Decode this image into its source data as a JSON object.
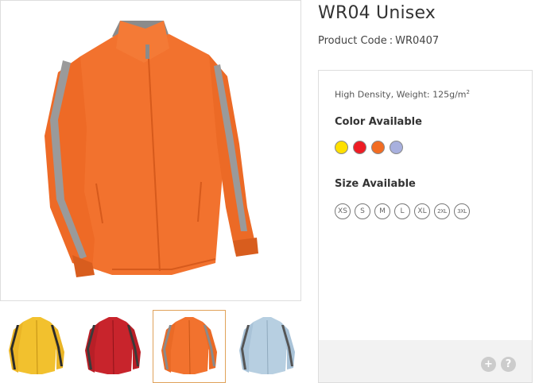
{
  "product": {
    "title": "WR04 Unisex",
    "code_label": "Product Code",
    "code_separator": ":",
    "code_value": "WR0407"
  },
  "gallery": {
    "main_alt": "Orange windbreaker jacket",
    "thumbnails": [
      {
        "color_name": "yellow",
        "fill": "#f2c12e",
        "stripe": "#2b2b2b"
      },
      {
        "color_name": "red",
        "fill": "#c8242c",
        "stripe": "#3a3a3a"
      },
      {
        "color_name": "orange",
        "fill": "#f2722e",
        "stripe": "#8a8a8a"
      },
      {
        "color_name": "light-blue",
        "fill": "#b7cfe1",
        "stripe": "#555555"
      }
    ],
    "active_index": 2
  },
  "specs": {
    "material_text": "High Density, Weight: 125g/m",
    "material_superscript": "2"
  },
  "colors": {
    "title": "Color Available",
    "swatches": [
      {
        "name": "yellow",
        "hex": "#ffe000"
      },
      {
        "name": "red",
        "hex": "#ee1c24"
      },
      {
        "name": "orange",
        "hex": "#f26c22"
      },
      {
        "name": "lavender",
        "hex": "#a8b0de"
      }
    ]
  },
  "sizes": {
    "title": "Size Available",
    "items": [
      "XS",
      "S",
      "M",
      "L",
      "XL",
      "2XL",
      "3XL"
    ]
  },
  "actions": {
    "zoom_symbol": "+",
    "help_symbol": "?"
  },
  "theme": {
    "main_jacket": "#f2722e",
    "main_stripe": "#9a9a9a",
    "active_border": "#e0a25a"
  }
}
